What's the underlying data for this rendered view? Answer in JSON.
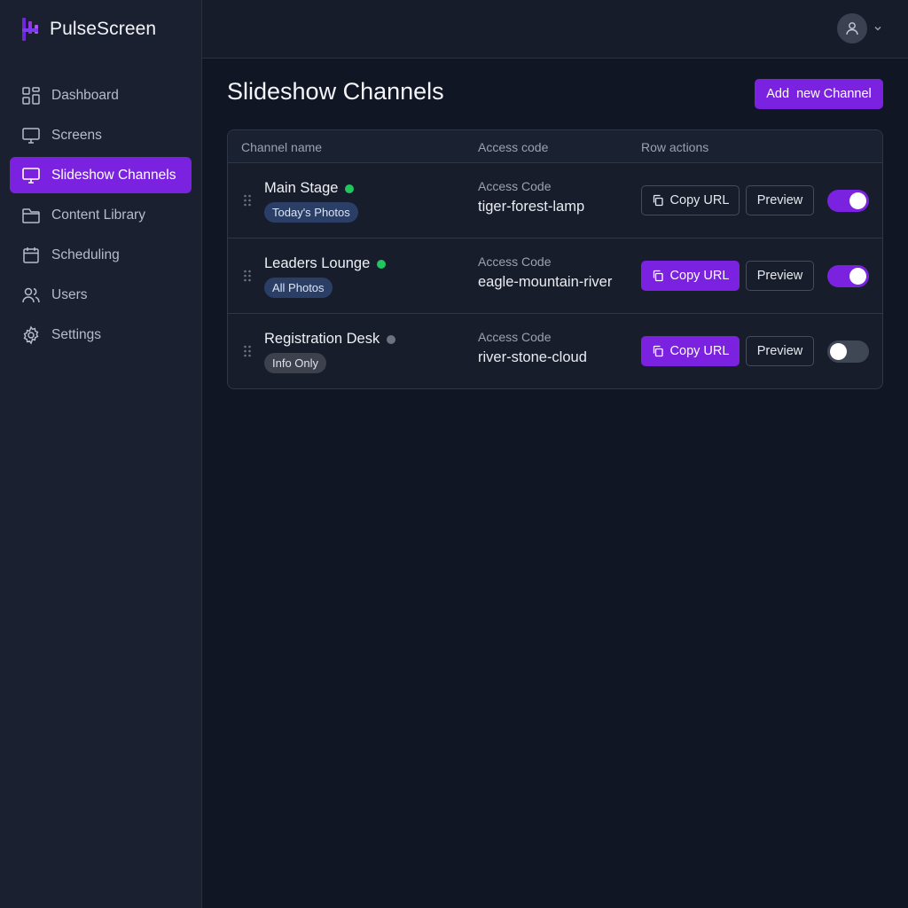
{
  "app": {
    "name": "PulseScreen"
  },
  "colors": {
    "accent": "#7a22e0",
    "online": "#22c55e",
    "offline": "#6b7280"
  },
  "sidebar": {
    "items": [
      {
        "label": "Dashboard",
        "icon": "dashboard-icon",
        "active": false
      },
      {
        "label": "Screens",
        "icon": "monitor-icon",
        "active": false
      },
      {
        "label": "Slideshow Channels",
        "icon": "monitor-icon",
        "active": true
      },
      {
        "label": "Content Library",
        "icon": "folder-icon",
        "active": false
      },
      {
        "label": "Scheduling",
        "icon": "calendar-icon",
        "active": false
      },
      {
        "label": "Users",
        "icon": "users-icon",
        "active": false
      },
      {
        "label": "Settings",
        "icon": "gear-icon",
        "active": false
      }
    ]
  },
  "header": {
    "avatar_icon": "user-icon",
    "caret_icon": "chevron-down-icon"
  },
  "main": {
    "title": "Slideshow Channels",
    "add_button": "Add  new Channel"
  },
  "table": {
    "columns": [
      "Channel name",
      "Access code",
      "Row actions"
    ],
    "rows": [
      {
        "name": "Main Stage",
        "status": "online",
        "tag": "Today's Photos",
        "code_label": "Access Code",
        "code": "tiger-forest-lamp",
        "copy_label": "Copy URL",
        "copy_style": "outline",
        "preview_label": "Preview",
        "enabled": true
      },
      {
        "name": "Leaders Lounge",
        "status": "online",
        "tag": "All Photos",
        "code_label": "Access Code",
        "code": "eagle-mountain-river",
        "copy_label": "Copy URL",
        "copy_style": "filled",
        "preview_label": "Preview",
        "enabled": true
      },
      {
        "name": "Registration Desk",
        "status": "offline",
        "tag": "Info Only",
        "code_label": "Access Code",
        "code": "river-stone-cloud",
        "copy_label": "Copy URL",
        "copy_style": "filled",
        "preview_label": "Preview",
        "enabled": false
      }
    ]
  }
}
